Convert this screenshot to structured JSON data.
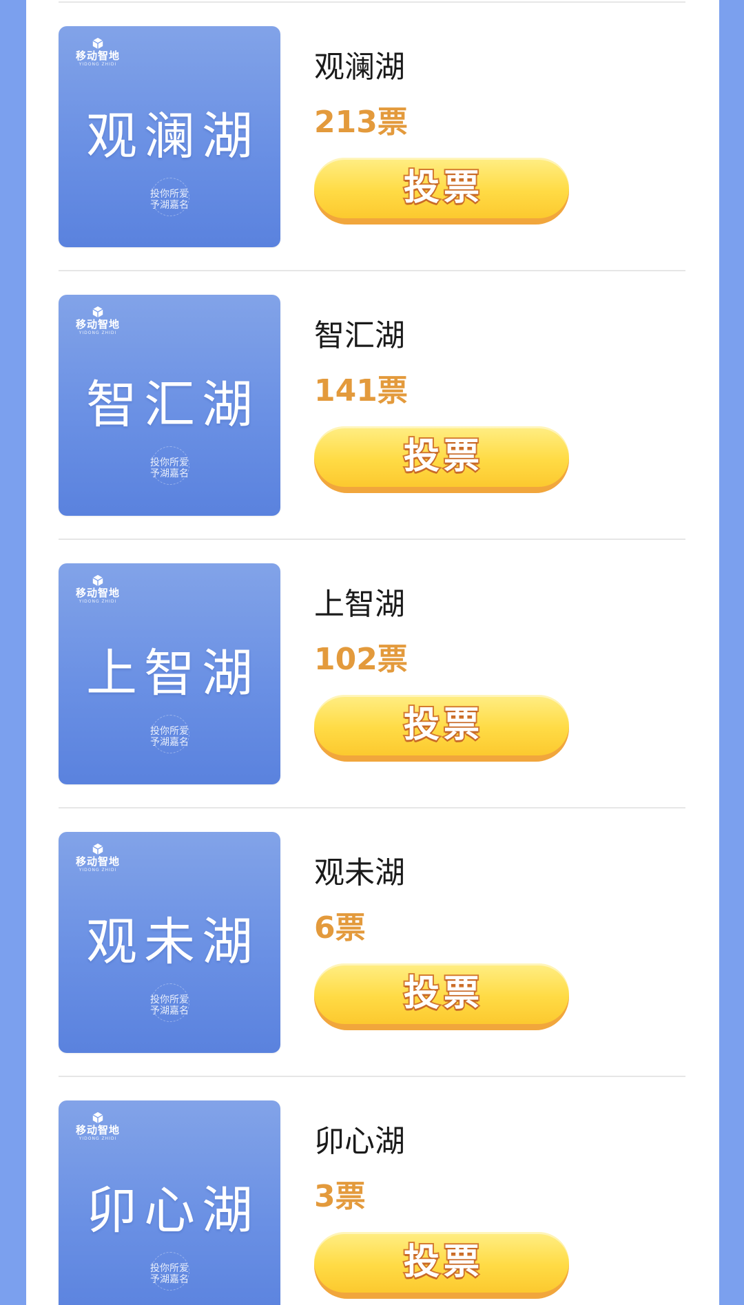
{
  "brand": {
    "name": "移动智地",
    "subtitle": "YIDONG ZHIDI"
  },
  "colors": {
    "page_side_background": "#7ba0ee",
    "card_background": "#ffffff",
    "thumbnail_blue": "#6a90e4",
    "votes_orange": "#e39a3c",
    "button_yellow": "#ffdb45",
    "button_outline": "#d47a2f"
  },
  "items": [
    {
      "thumb_title": "观澜湖",
      "slogan_line1": "投你所爱",
      "slogan_line2": "予湖嘉名",
      "name": "观澜湖",
      "votes_text": "213票",
      "votes": 213,
      "button_label": "投票"
    },
    {
      "thumb_title": "智汇湖",
      "slogan_line1": "投你所爱",
      "slogan_line2": "予湖嘉名",
      "name": "智汇湖",
      "votes_text": "141票",
      "votes": 141,
      "button_label": "投票"
    },
    {
      "thumb_title": "上智湖",
      "slogan_line1": "投你所爱",
      "slogan_line2": "予湖嘉名",
      "name": "上智湖",
      "votes_text": "102票",
      "votes": 102,
      "button_label": "投票"
    },
    {
      "thumb_title": "观未湖",
      "slogan_line1": "投你所爱",
      "slogan_line2": "予湖嘉名",
      "name": "观未湖",
      "votes_text": "6票",
      "votes": 6,
      "button_label": "投票"
    },
    {
      "thumb_title": "卯心湖",
      "slogan_line1": "投你所爱",
      "slogan_line2": "予湖嘉名",
      "name": "卯心湖",
      "votes_text": "3票",
      "votes": 3,
      "button_label": "投票"
    }
  ]
}
